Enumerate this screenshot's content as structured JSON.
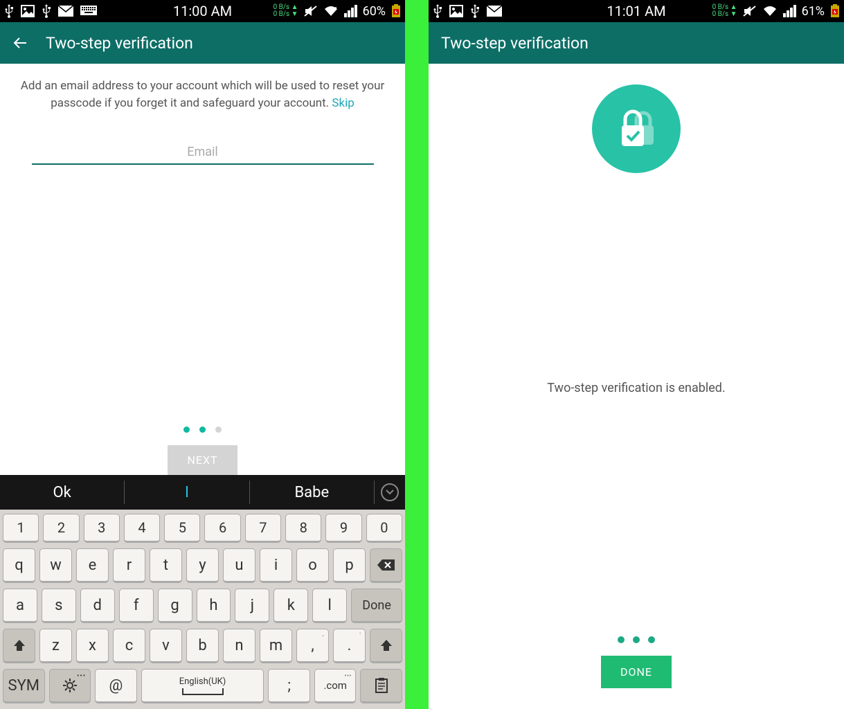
{
  "left": {
    "status": {
      "time": "11:00 AM",
      "rate_up": "0 B/s",
      "rate_down": "0 B/s",
      "battery": "60%"
    },
    "appbar": {
      "title": "Two-step verification"
    },
    "desc_pre": "Add an email address to your account which will be used to reset your passcode if you forget it and safeguard your account. ",
    "skip": "Skip",
    "email_placeholder": "Email",
    "next": "NEXT",
    "suggestions": {
      "s1": "Ok",
      "s2": "I",
      "s3": "Babe"
    },
    "keys": {
      "row1": [
        "1",
        "2",
        "3",
        "4",
        "5",
        "6",
        "7",
        "8",
        "9",
        "0"
      ],
      "row2": [
        "q",
        "w",
        "e",
        "r",
        "t",
        "y",
        "u",
        "i",
        "o",
        "p"
      ],
      "row3": [
        "a",
        "s",
        "d",
        "f",
        "g",
        "h",
        "j",
        "k",
        "l"
      ],
      "done": "Done",
      "row4": [
        "z",
        "x",
        "c",
        "v",
        "b",
        "n",
        "m",
        ",",
        "."
      ],
      "sym": "SYM",
      "at": "@",
      "space": "English(UK)",
      "semi": ";",
      "com": ".com"
    }
  },
  "right": {
    "status": {
      "time": "11:01 AM",
      "rate_up": "0 B/s",
      "rate_down": "0 B/s",
      "battery": "61%"
    },
    "appbar": {
      "title": "Two-step verification"
    },
    "message": "Two-step verification is enabled.",
    "done": "DONE"
  }
}
